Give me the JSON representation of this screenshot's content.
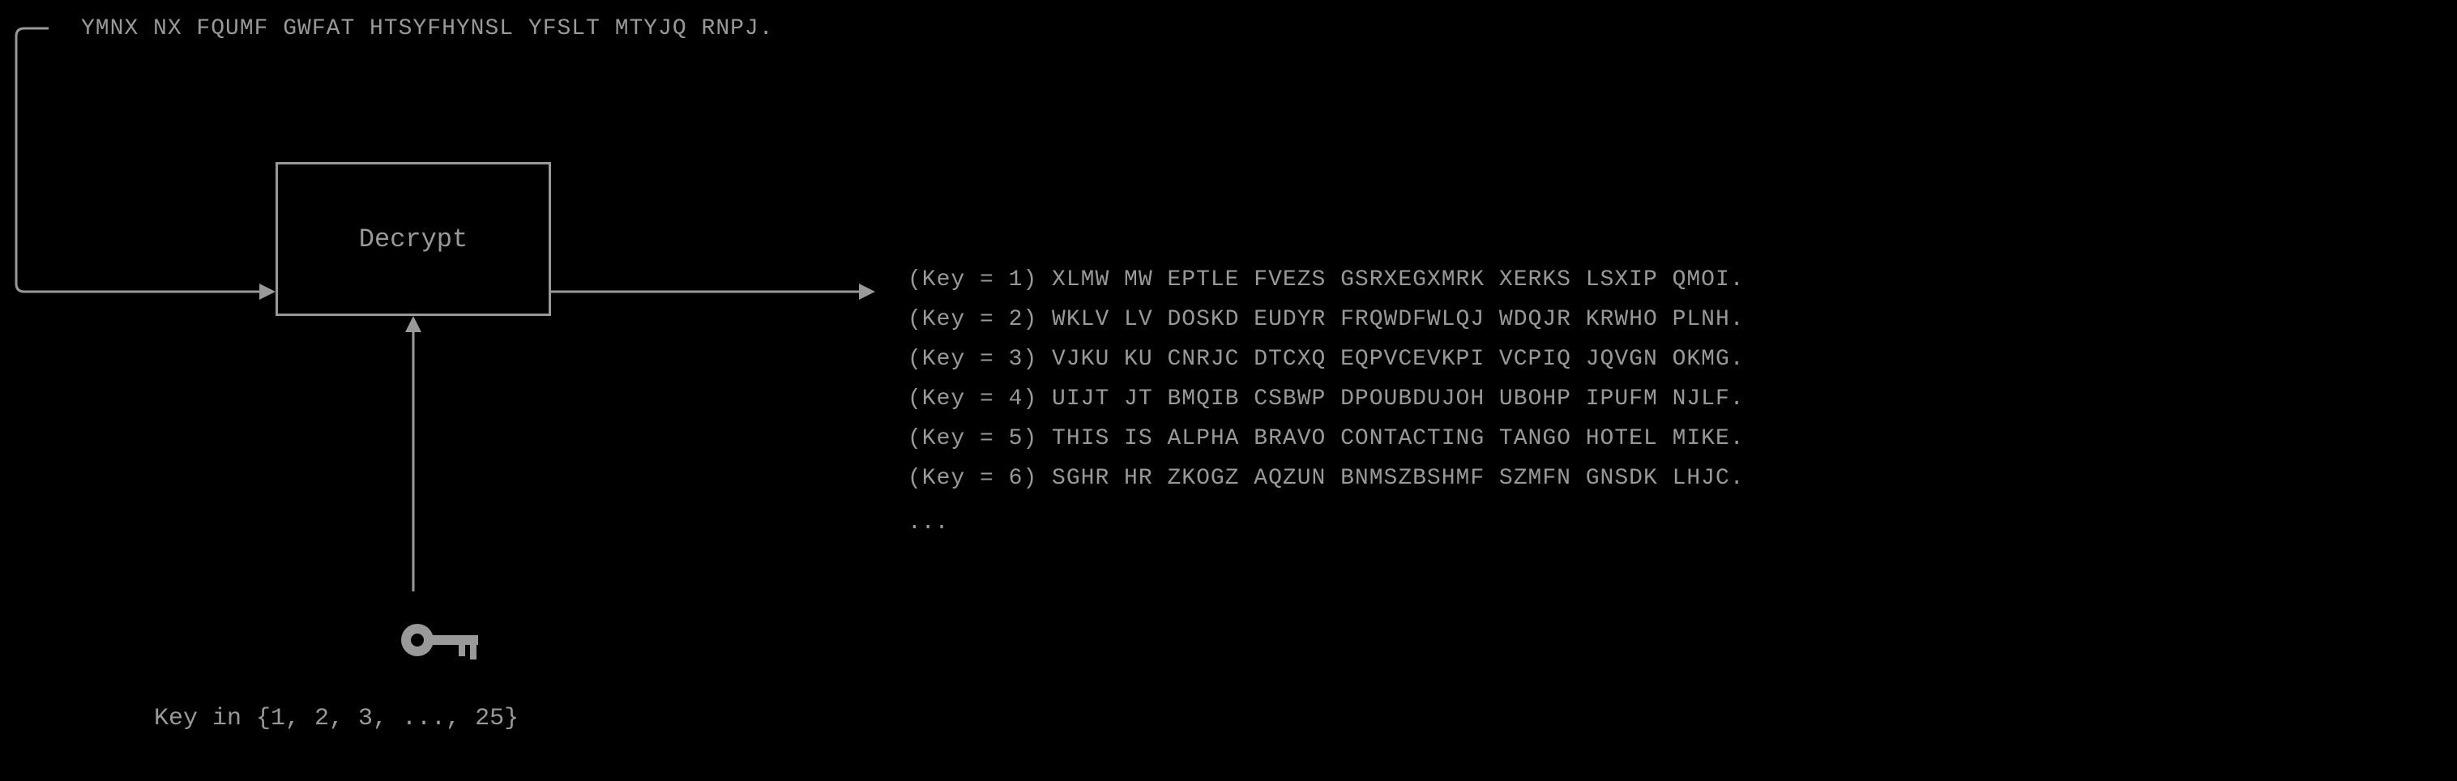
{
  "cipher_text": "YMNX NX FQUMF GWFAT HTSYFHYNSL YFSLT MTYJQ RNPJ.",
  "decrypt_label": "Decrypt",
  "key_range_label": "Key in {1, 2, 3, ..., 25}",
  "outputs": [
    {
      "key": 1,
      "text": "XLMW MW EPTLE FVEZS GSRXEGXMRK XERKS LSXIP QMOI."
    },
    {
      "key": 2,
      "text": "WKLV LV DOSKD EUDYR FRQWDFWLQJ WDQJR KRWHO PLNH."
    },
    {
      "key": 3,
      "text": "VJKU KU CNRJC DTCXQ EQPVCEVKPI VCPIQ JQVGN OKMG."
    },
    {
      "key": 4,
      "text": "UIJT JT BMQIB CSBWP DPOUBDUJOH UBOHP IPUFM NJLF."
    },
    {
      "key": 5,
      "text": "THIS IS ALPHA BRAVO CONTACTING TANGO HOTEL MIKE."
    },
    {
      "key": 6,
      "text": "SGHR HR ZKOGZ AQZUN BNMSZBSHMF SZMFN GNSDK LHJC."
    }
  ],
  "ellipsis": "...",
  "colors": {
    "fg": "#999",
    "bg": "#000"
  }
}
